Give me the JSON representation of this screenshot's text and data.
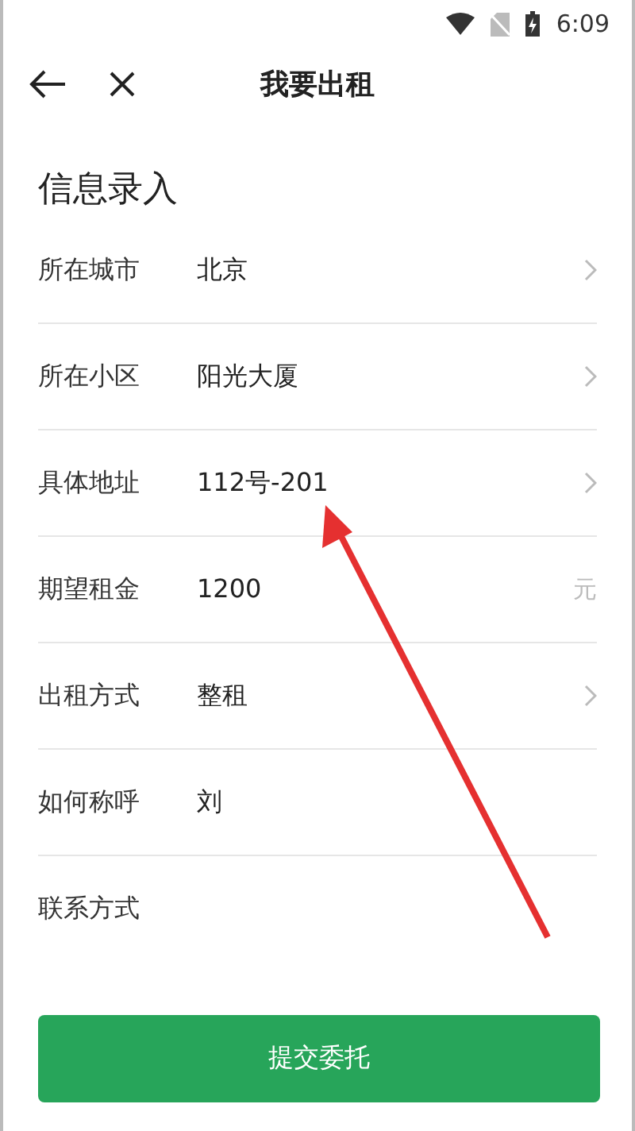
{
  "status_bar": {
    "time": "6:09"
  },
  "header": {
    "title": "我要出租"
  },
  "section_title": "信息录入",
  "fields": [
    {
      "kind": "select",
      "label": "所在城市",
      "value": "北京"
    },
    {
      "kind": "select",
      "label": "所在小区",
      "value": "阳光大厦"
    },
    {
      "kind": "select",
      "label": "具体地址",
      "value": "112号-201"
    },
    {
      "kind": "input",
      "label": "期望租金",
      "value": "1200",
      "suffix": "元"
    },
    {
      "kind": "select",
      "label": "出租方式",
      "value": "整租"
    },
    {
      "kind": "input",
      "label": "如何称呼",
      "value": "刘"
    },
    {
      "kind": "input",
      "label": "联系方式"
    }
  ],
  "submit_button": "提交委托"
}
